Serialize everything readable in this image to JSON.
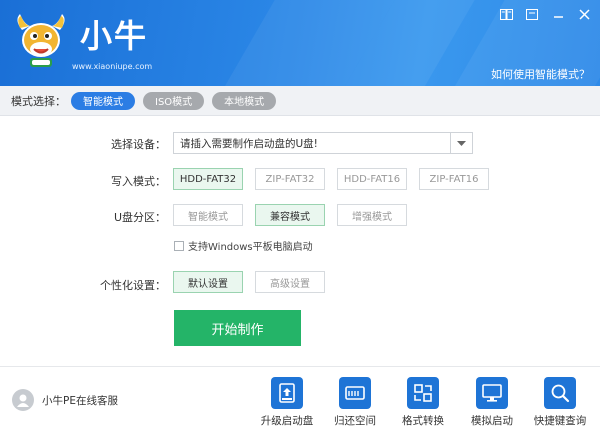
{
  "header": {
    "brand_name": "小牛",
    "brand_url": "www.xiaoniupe.com",
    "help_link": "如何使用智能模式？"
  },
  "modebar": {
    "label": "模式选择：",
    "modes": [
      {
        "label": "智能模式",
        "active": true
      },
      {
        "label": "ISO模式",
        "active": false
      },
      {
        "label": "本地模式",
        "active": false
      }
    ]
  },
  "form": {
    "device_label": "选择设备：",
    "device_value": "请插入需要制作启动盘的U盘!",
    "write_label": "写入模式：",
    "write_options": [
      {
        "label": "HDD-FAT32",
        "selected": true
      },
      {
        "label": "ZIP-FAT32",
        "selected": false
      },
      {
        "label": "HDD-FAT16",
        "selected": false
      },
      {
        "label": "ZIP-FAT16",
        "selected": false
      }
    ],
    "partition_label": "U盘分区：",
    "partition_options": [
      {
        "label": "智能模式",
        "selected": false
      },
      {
        "label": "兼容模式",
        "selected": true
      },
      {
        "label": "增强模式",
        "selected": false
      }
    ],
    "tablet_checkbox": "支持Windows平板电脑启动",
    "tablet_checked": false,
    "personal_label": "个性化设置：",
    "personal_options": [
      {
        "label": "默认设置",
        "selected": true
      },
      {
        "label": "高级设置",
        "selected": false
      }
    ],
    "start_button": "开始制作"
  },
  "footer": {
    "service": "小牛PE在线客服",
    "tools": [
      {
        "label": "升级启动盘",
        "icon": "usb-upgrade-icon"
      },
      {
        "label": "归还空间",
        "icon": "drive-icon"
      },
      {
        "label": "格式转换",
        "icon": "convert-icon"
      },
      {
        "label": "模拟启动",
        "icon": "monitor-icon"
      },
      {
        "label": "快捷键查询",
        "icon": "search-icon"
      }
    ]
  },
  "colors": {
    "header_blue": "#2a86e6",
    "active_blue": "#2b7de4",
    "start_green": "#24b468",
    "icon_blue": "#1e74d6"
  }
}
